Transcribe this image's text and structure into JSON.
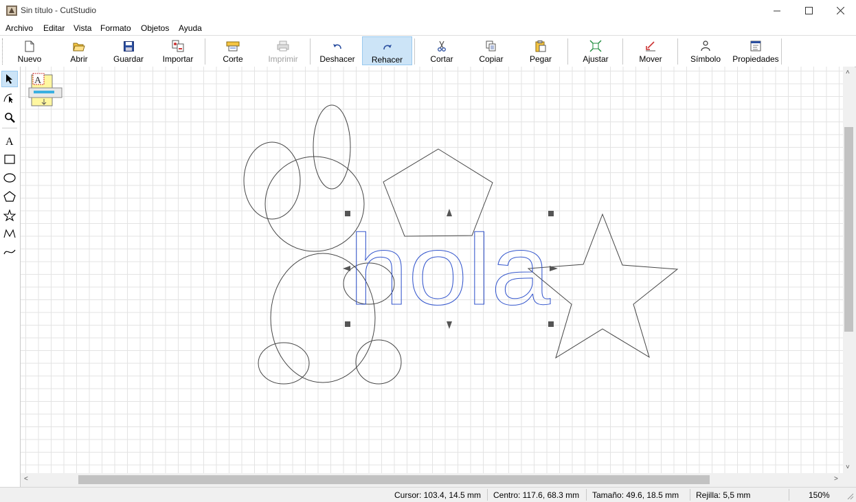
{
  "window": {
    "title": "Sin título - CutStudio"
  },
  "menu": [
    "Archivo",
    "Editar",
    "Vista",
    "Formato",
    "Objetos",
    "Ayuda"
  ],
  "toolbar": {
    "nuevo": "Nuevo",
    "abrir": "Abrir",
    "guardar": "Guardar",
    "importar": "Importar",
    "corte": "Corte",
    "imprimir": "Imprimir",
    "deshacer": "Deshacer",
    "rehacer": "Rehacer",
    "cortar": "Cortar",
    "copiar": "Copiar",
    "pegar": "Pegar",
    "ajustar": "Ajustar",
    "mover": "Mover",
    "simbolo": "Símbolo",
    "propiedades": "Propiedades"
  },
  "toolbar_state": {
    "disabled": [
      "Imprimir"
    ],
    "active": "Rehacer"
  },
  "tools": [
    "select-tool",
    "edit-points-tool",
    "zoom-tool",
    "text-tool",
    "rectangle-tool",
    "ellipse-tool",
    "polygon-tool",
    "star-tool",
    "polyline-tool",
    "curve-tool"
  ],
  "active_tool": "select-tool",
  "canvas": {
    "text_object": "hola",
    "text_color": "#3355cc",
    "shape_color": "#444444"
  },
  "status": {
    "cursor": "Cursor: 103.4, 14.5 mm",
    "center": "Centro: 117.6, 68.3 mm",
    "size": "Tamaño: 49.6, 18.5 mm",
    "grid": "Rejilla: 5,5 mm",
    "zoom": "150%"
  }
}
